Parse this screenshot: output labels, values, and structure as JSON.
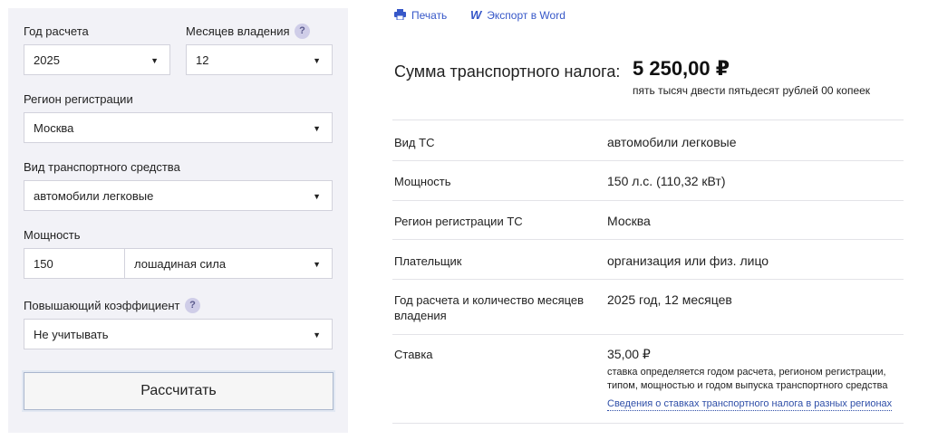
{
  "form": {
    "year": {
      "label": "Год расчета",
      "value": "2025"
    },
    "months": {
      "label": "Месяцев владения",
      "value": "12",
      "help": "?"
    },
    "region": {
      "label": "Регион регистрации",
      "value": "Москва"
    },
    "vehicle_type": {
      "label": "Вид транспортного средства",
      "value": "автомобили легковые"
    },
    "power": {
      "label": "Мощность",
      "value": "150",
      "unit": "лошадиная сила"
    },
    "coefficient": {
      "label": "Повышающий коэффициент",
      "value": "Не учитывать",
      "help": "?"
    },
    "submit_label": "Рассчитать",
    "caret": "▼"
  },
  "toolbar": {
    "print_label": "Печать",
    "print_icon": "printer-icon",
    "word_label": "Экспорт в Word",
    "word_icon": "word-icon",
    "word_glyph": "W",
    "accent_color": "#3657c8"
  },
  "result": {
    "sum_label": "Сумма транспортного налога:",
    "sum_value": "5 250,00 ₽",
    "sum_words": "пять тысяч двести пятьдесят рублей 00 копеек",
    "rows": [
      {
        "key": "Вид ТС",
        "value": "автомобили легковые"
      },
      {
        "key": "Мощность",
        "value": "150 л.с. (110,32 кВт)"
      },
      {
        "key": "Регион регистрации ТС",
        "value": "Москва"
      },
      {
        "key": "Плательщик",
        "value": "организация или физ. лицо"
      },
      {
        "key": "Год расчета и количество месяцев владения",
        "value": "2025 год, 12 месяцев"
      },
      {
        "key": "Ставка",
        "value": "35,00 ₽"
      }
    ],
    "rate_note": "ставка определяется годом расчета, регионом регистрации, типом, мощностью и годом выпуска транспортного средства",
    "rate_link": "Сведения о ставках транспортного налога в разных регионах"
  }
}
